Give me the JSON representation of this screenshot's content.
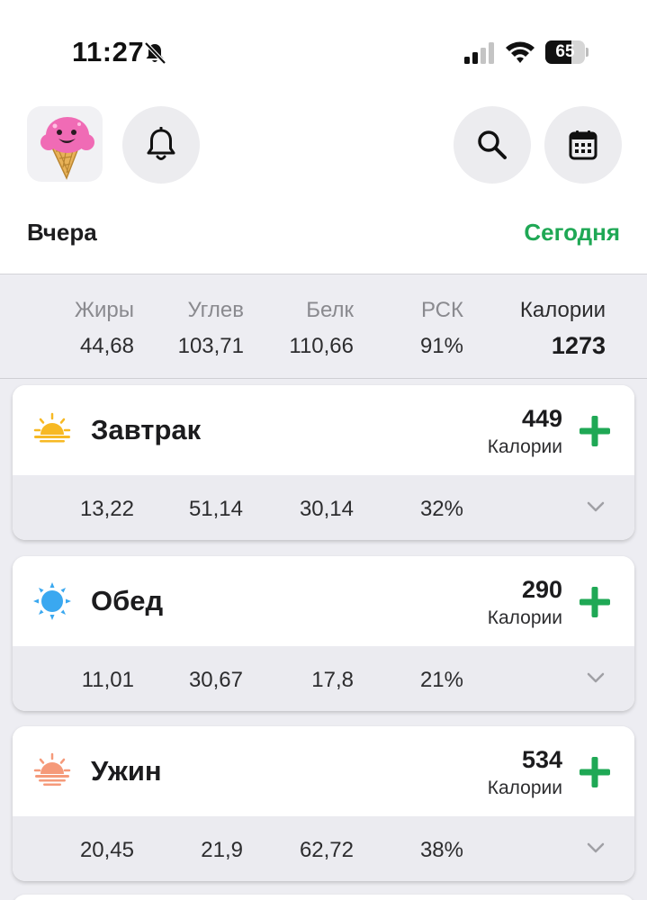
{
  "status_bar": {
    "time": "11:27",
    "battery": "65",
    "battery_level": 0.65,
    "icons": [
      "bell-slash-icon",
      "cellular-signal-icon",
      "wifi-icon",
      "battery-icon"
    ]
  },
  "header": {
    "avatar_icon": "ice-cream-icon",
    "buttons": [
      "bell-icon",
      "search-icon",
      "calendar-icon"
    ],
    "prev_day": "Вчера",
    "next_day": "Сегодня"
  },
  "summary": {
    "fat_label": "Жиры",
    "fat_value": "44,68",
    "carbs_label": "Углев",
    "carbs_value": "103,71",
    "protein_label": "Белк",
    "protein_value": "110,66",
    "rsk_label": "РСК",
    "rsk_value": "91%",
    "calories_label": "Калории",
    "calories_value": "1273"
  },
  "meals": [
    {
      "name": "Завтрак",
      "icon": "sunrise-icon",
      "calories": "449",
      "calories_label": "Калории",
      "fat": "13,22",
      "carbs": "51,14",
      "protein": "30,14",
      "rsk": "32%"
    },
    {
      "name": "Обед",
      "icon": "sun-icon",
      "calories": "290",
      "calories_label": "Калории",
      "fat": "11,01",
      "carbs": "30,67",
      "protein": "17,8",
      "rsk": "21%"
    },
    {
      "name": "Ужин",
      "icon": "sunset-icon",
      "calories": "534",
      "calories_label": "Калории",
      "fat": "20,45",
      "carbs": "21,9",
      "protein": "62,72",
      "rsk": "38%"
    }
  ],
  "colors": {
    "accent_green": "#1fa855",
    "sunrise": "#f7b924",
    "sun": "#3aa8f0",
    "sunset": "#f59a7a",
    "summary_bg": "#ededf2"
  }
}
